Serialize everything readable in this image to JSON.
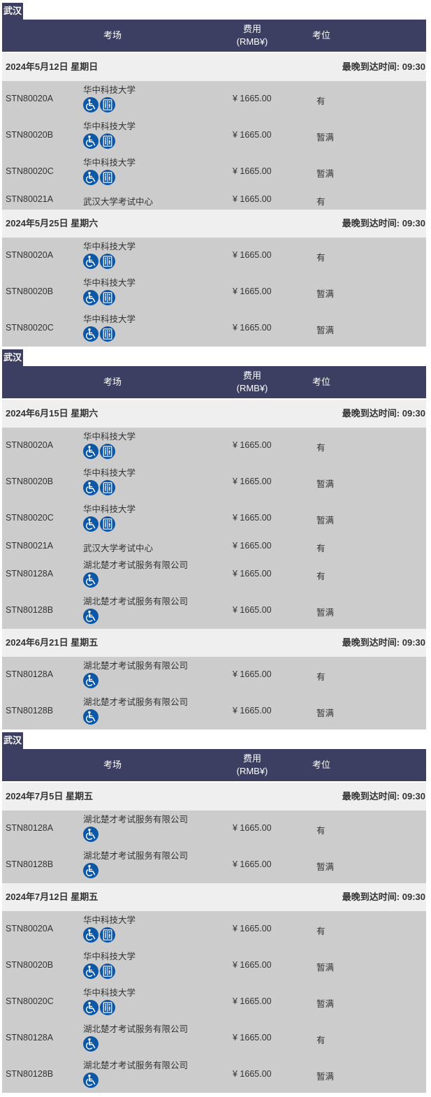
{
  "header_labels": {
    "venue": "考场",
    "fee_line1": "费用",
    "fee_line2": "(RMB¥)",
    "seat": "考位"
  },
  "arrival_label": "最晚到达时间:",
  "currency": "¥",
  "colors": {
    "header_bg": "#3c3f61",
    "date_bg": "#efefef",
    "row_bg": "#cccccc",
    "icon_blue": "#0d57a7"
  },
  "icons": {
    "wheelchair": "wheelchair-icon",
    "accessible_room": "accessible-restroom-icon"
  },
  "blocks": [
    {
      "city": "武汉",
      "groups": [
        {
          "date": "2024年5月12日 星期日",
          "arrival": "09:30",
          "rows": [
            {
              "code": "STN80020A",
              "venue": "华中科技大学",
              "fee": "1665.00",
              "seat": "有",
              "icons": [
                "wheelchair",
                "accessible_room"
              ]
            },
            {
              "code": "STN80020B",
              "venue": "华中科技大学",
              "fee": "1665.00",
              "seat": "暂满",
              "icons": [
                "wheelchair",
                "accessible_room"
              ]
            },
            {
              "code": "STN80020C",
              "venue": "华中科技大学",
              "fee": "1665.00",
              "seat": "暂满",
              "icons": [
                "wheelchair",
                "accessible_room"
              ]
            },
            {
              "code": "STN80021A",
              "venue": "武汉大学考试中心",
              "fee": "1665.00",
              "seat": "有",
              "icons": []
            }
          ]
        },
        {
          "date": "2024年5月25日 星期六",
          "arrival": "09:30",
          "rows": [
            {
              "code": "STN80020A",
              "venue": "华中科技大学",
              "fee": "1665.00",
              "seat": "有",
              "icons": [
                "wheelchair",
                "accessible_room"
              ]
            },
            {
              "code": "STN80020B",
              "venue": "华中科技大学",
              "fee": "1665.00",
              "seat": "暂满",
              "icons": [
                "wheelchair",
                "accessible_room"
              ]
            },
            {
              "code": "STN80020C",
              "venue": "华中科技大学",
              "fee": "1665.00",
              "seat": "暂满",
              "icons": [
                "wheelchair",
                "accessible_room"
              ]
            }
          ]
        }
      ]
    },
    {
      "city": "武汉",
      "groups": [
        {
          "date": "2024年6月15日 星期六",
          "arrival": "09:30",
          "rows": [
            {
              "code": "STN80020A",
              "venue": "华中科技大学",
              "fee": "1665.00",
              "seat": "有",
              "icons": [
                "wheelchair",
                "accessible_room"
              ]
            },
            {
              "code": "STN80020B",
              "venue": "华中科技大学",
              "fee": "1665.00",
              "seat": "暂满",
              "icons": [
                "wheelchair",
                "accessible_room"
              ]
            },
            {
              "code": "STN80020C",
              "venue": "华中科技大学",
              "fee": "1665.00",
              "seat": "暂满",
              "icons": [
                "wheelchair",
                "accessible_room"
              ]
            },
            {
              "code": "STN80021A",
              "venue": "武汉大学考试中心",
              "fee": "1665.00",
              "seat": "有",
              "icons": []
            },
            {
              "code": "STN80128A",
              "venue": "湖北楚才考试服务有限公司",
              "fee": "1665.00",
              "seat": "有",
              "icons": [
                "wheelchair"
              ]
            },
            {
              "code": "STN80128B",
              "venue": "湖北楚才考试服务有限公司",
              "fee": "1665.00",
              "seat": "暂满",
              "icons": [
                "wheelchair"
              ]
            }
          ]
        },
        {
          "date": "2024年6月21日 星期五",
          "arrival": "09:30",
          "rows": [
            {
              "code": "STN80128A",
              "venue": "湖北楚才考试服务有限公司",
              "fee": "1665.00",
              "seat": "有",
              "icons": [
                "wheelchair"
              ]
            },
            {
              "code": "STN80128B",
              "venue": "湖北楚才考试服务有限公司",
              "fee": "1665.00",
              "seat": "暂满",
              "icons": [
                "wheelchair"
              ]
            }
          ]
        }
      ]
    },
    {
      "city": "武汉",
      "groups": [
        {
          "date": "2024年7月5日 星期五",
          "arrival": "09:30",
          "rows": [
            {
              "code": "STN80128A",
              "venue": "湖北楚才考试服务有限公司",
              "fee": "1665.00",
              "seat": "有",
              "icons": [
                "wheelchair"
              ]
            },
            {
              "code": "STN80128B",
              "venue": "湖北楚才考试服务有限公司",
              "fee": "1665.00",
              "seat": "暂满",
              "icons": [
                "wheelchair"
              ]
            }
          ]
        },
        {
          "date": "2024年7月12日 星期五",
          "arrival": "09:30",
          "rows": [
            {
              "code": "STN80020A",
              "venue": "华中科技大学",
              "fee": "1665.00",
              "seat": "有",
              "icons": [
                "wheelchair",
                "accessible_room"
              ]
            },
            {
              "code": "STN80020B",
              "venue": "华中科技大学",
              "fee": "1665.00",
              "seat": "暂满",
              "icons": [
                "wheelchair",
                "accessible_room"
              ]
            },
            {
              "code": "STN80020C",
              "venue": "华中科技大学",
              "fee": "1665.00",
              "seat": "暂满",
              "icons": [
                "wheelchair",
                "accessible_room"
              ]
            },
            {
              "code": "STN80128A",
              "venue": "湖北楚才考试服务有限公司",
              "fee": "1665.00",
              "seat": "有",
              "icons": [
                "wheelchair"
              ]
            },
            {
              "code": "STN80128B",
              "venue": "湖北楚才考试服务有限公司",
              "fee": "1665.00",
              "seat": "暂满",
              "icons": [
                "wheelchair"
              ]
            }
          ]
        }
      ]
    }
  ]
}
